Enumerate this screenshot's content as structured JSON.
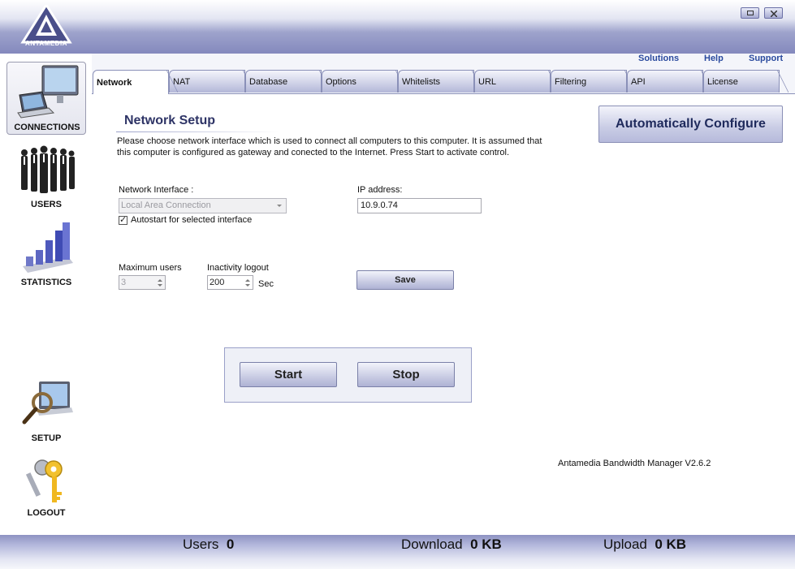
{
  "app": {
    "logo_text": "ANTAMEDIA",
    "version": "Antamedia Bandwidth Manager V2.6.2"
  },
  "top_links": {
    "solutions": "Solutions",
    "help": "Help",
    "support": "Support"
  },
  "sidebar": {
    "items": [
      {
        "label": "CONNECTIONS",
        "icon": "computer-icon",
        "active": true
      },
      {
        "label": "USERS",
        "icon": "people-icon",
        "active": false
      },
      {
        "label": "STATISTICS",
        "icon": "bar-chart-icon",
        "active": false
      },
      {
        "label": "SETUP",
        "icon": "magnifier-monitor-icon",
        "active": false
      },
      {
        "label": "LOGOUT",
        "icon": "keys-icon",
        "active": false
      }
    ]
  },
  "tabs": [
    {
      "label": "Network",
      "active": true
    },
    {
      "label": "NAT"
    },
    {
      "label": "Database"
    },
    {
      "label": "Options"
    },
    {
      "label": "Whitelists"
    },
    {
      "label": "URL"
    },
    {
      "label": "Filtering"
    },
    {
      "label": "API"
    },
    {
      "label": "License"
    }
  ],
  "network": {
    "title": "Network Setup",
    "description": "Please choose network interface which is used to connect all computers to this computer. It is assumed that this computer is configured as gateway and conected to the Internet. Press Start to activate control.",
    "auto_configure": "Automatically Configure",
    "interface_label": "Network Interface :",
    "interface_value": "Local Area Connection",
    "autostart_label": "Autostart for selected interface",
    "autostart_checked": true,
    "ip_label": "IP address:",
    "ip_value": "10.9.0.74",
    "max_users_label": "Maximum users",
    "max_users_value": "3",
    "inactivity_label": "Inactivity logout",
    "inactivity_value": "200",
    "inactivity_unit": "Sec",
    "save": "Save",
    "start": "Start",
    "stop": "Stop"
  },
  "status": {
    "users_label": "Users",
    "users_value": "0",
    "download_label": "Download",
    "download_value": "0 KB",
    "upload_label": "Upload",
    "upload_value": "0 KB"
  },
  "colors": {
    "accent": "#2e3466",
    "link": "#2a4a9e",
    "band": "#8489bd"
  }
}
